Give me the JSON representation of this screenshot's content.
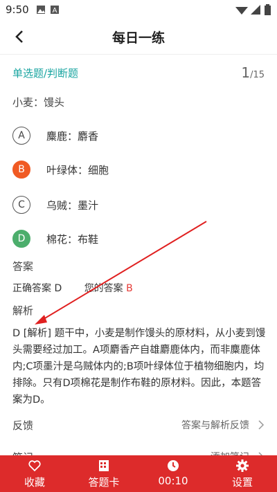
{
  "status": {
    "time": "9:50"
  },
  "header": {
    "title": "每日一练"
  },
  "question": {
    "type": "单选题/判断题",
    "current": "1",
    "total": "/15",
    "stem": "小麦：馒头",
    "options": [
      {
        "letter": "A",
        "text": "麋鹿：麝香",
        "state": "normal"
      },
      {
        "letter": "B",
        "text": "叶绿体：细胞",
        "state": "wrong"
      },
      {
        "letter": "C",
        "text": "乌贼：墨汁",
        "state": "normal"
      },
      {
        "letter": "D",
        "text": "棉花：布鞋",
        "state": "correct"
      }
    ]
  },
  "answer": {
    "label": "答案",
    "correct": "正确答案 D",
    "mine_label": "您的答案",
    "mine_value": "B"
  },
  "analysis": {
    "label": "解析",
    "text": "D [解析] 题干中，小麦是制作馒头的原材料，从小麦到馒头需要经过加工。A项麝香产自雄麝鹿体内，而非麋鹿体内;C项墨汁是乌贼体内的;B项叶绿体位于植物细胞内，均排除。只有D项棉花是制作布鞋的原材料。因此，本题答案为D。"
  },
  "feedback": {
    "label": "反馈",
    "action": "答案与解析反馈"
  },
  "notes": {
    "label": "笔记",
    "action": "添加笔记"
  },
  "tabbar": {
    "favorite": "收藏",
    "answer_card": "答题卡",
    "timer": "00:10",
    "settings": "设置"
  },
  "colors": {
    "accent": "#1aa5a1",
    "wrong": "#f05a23",
    "correct": "#4cae6c",
    "tabbar": "#dd2b2b"
  }
}
